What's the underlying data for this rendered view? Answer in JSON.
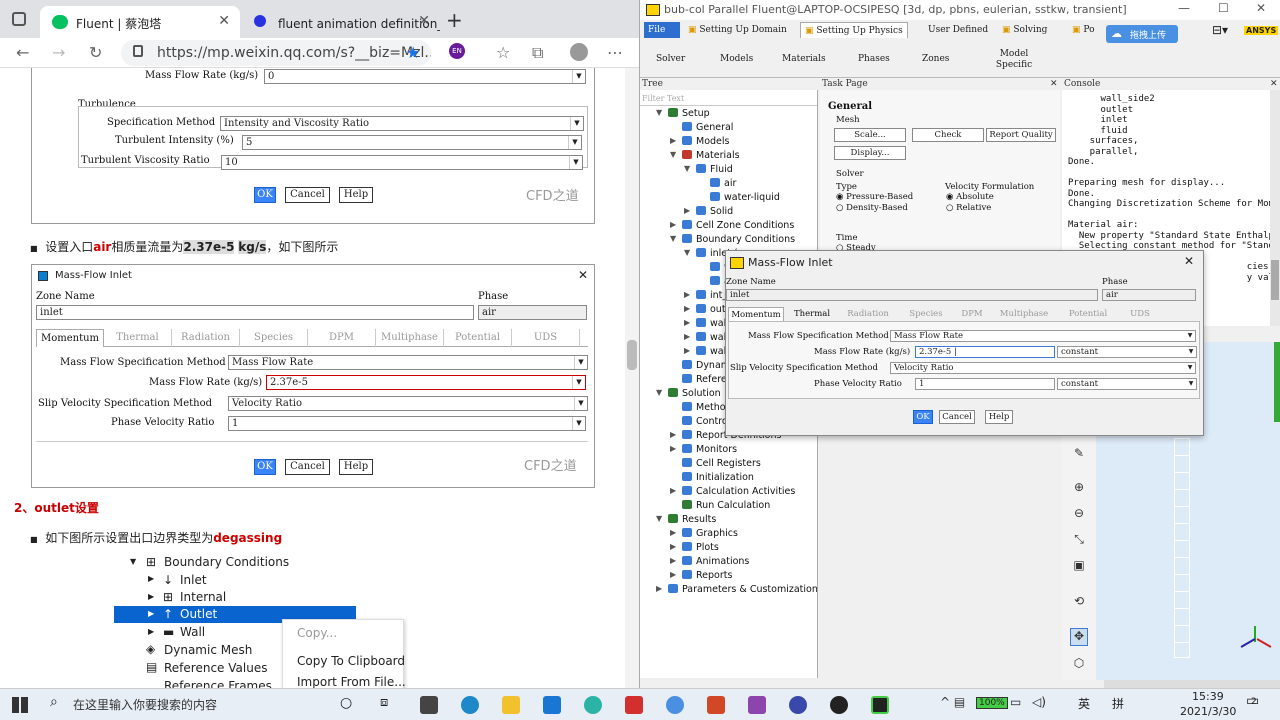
{
  "browser": {
    "tabs": [
      {
        "label": "Fluent | 蔡泡塔"
      },
      {
        "label": "fluent animation definition_百度"
      }
    ],
    "url": "https://mp.weixin.qq.com/s?__biz=Mzl...",
    "profile": "EN"
  },
  "article": {
    "fig1": {
      "mass_flow_label": "Mass Flow Rate (kg/s)",
      "mass_flow_value": "0",
      "turbulence": "Turbulence",
      "spec_label": "Specification Method",
      "spec_value": "Intensity and Viscosity Ratio",
      "ti_label": "Turbulent Intensity (%)",
      "ti_value": "5",
      "tvr_label": "Turbulent Viscosity Ratio",
      "tvr_value": "10",
      "ok": "OK",
      "cancel": "Cancel",
      "help": "Help",
      "watermark": "CFD之道"
    },
    "para1": {
      "pre": "设置入口",
      "air": "air",
      "mid": "相质量流量为",
      "val": "2.37e-5",
      "unit": "kg/s",
      "post": "，如下图所示"
    },
    "fig2": {
      "title": "Mass-Flow Inlet",
      "zone_label": "Zone Name",
      "zone_value": "inlet",
      "phase_label": "Phase",
      "phase_value": "air",
      "tabs": [
        "Momentum",
        "Thermal",
        "Radiation",
        "Species",
        "DPM",
        "Multiphase",
        "Potential",
        "UDS"
      ],
      "rows": [
        {
          "label": "Mass Flow Specification Method",
          "value": "Mass Flow Rate"
        },
        {
          "label": "Mass Flow Rate (kg/s)",
          "value": "2.37e-5"
        },
        {
          "label": "Slip Velocity Specification Method",
          "value": "Velocity Ratio"
        },
        {
          "label": "Phase Velocity Ratio",
          "value": "1"
        }
      ],
      "ok": "OK",
      "cancel": "Cancel",
      "help": "Help",
      "watermark": "CFD之道"
    },
    "heading2": "2、outlet设置",
    "para2": {
      "pre": "如下图所示设置出口边界类型为",
      "val": "degassing"
    },
    "tree": {
      "root": "Boundary Conditions",
      "items": [
        "Inlet",
        "Internal",
        "Outlet",
        "Wall",
        "Dynamic Mesh",
        "Reference Values",
        "Reference Frames"
      ]
    },
    "context_menu": [
      "Copy...",
      "Copy To Clipboard",
      "Import From File..."
    ]
  },
  "fluent": {
    "title": "bub-col Parallel Fluent@LAPTOP-OCSIPESQ  [3d, dp, pbns, eulerian, sstkw, transient]",
    "ribbon_tabs": [
      "File",
      "Setting Up Domain",
      "Setting Up Physics",
      "User Defined",
      "Solving",
      "Po"
    ],
    "ribbon_buttons": [
      "Solver",
      "Models",
      "Materials",
      "Phases",
      "Zones",
      "Model Specific"
    ],
    "cloud_label": "拖拽上传",
    "brand": "ANSYS",
    "panels": {
      "tree": "Tree",
      "task": "Task Page",
      "console": "Console"
    },
    "filter_placeholder": "Filter Text",
    "tree": [
      {
        "label": "Setup"
      },
      {
        "label": "General"
      },
      {
        "label": "Models"
      },
      {
        "label": "Materials"
      },
      {
        "label": "Fluid"
      },
      {
        "label": "air"
      },
      {
        "label": "water-liquid"
      },
      {
        "label": "Solid"
      },
      {
        "label": "Cell Zone Conditions"
      },
      {
        "label": "Boundary Conditions"
      },
      {
        "label": "inlet (n"
      },
      {
        "label": "wat"
      },
      {
        "label": "air"
      },
      {
        "label": "int_flu"
      },
      {
        "label": "outlet"
      },
      {
        "label": "wall_b"
      },
      {
        "label": "wall_s"
      },
      {
        "label": "wall_s"
      },
      {
        "label": "Dynamic"
      },
      {
        "label": "Reference"
      },
      {
        "label": "Solution"
      },
      {
        "label": "Methods"
      },
      {
        "label": "Controls"
      },
      {
        "label": "Report Definitions"
      },
      {
        "label": "Monitors"
      },
      {
        "label": "Cell Registers"
      },
      {
        "label": "Initialization"
      },
      {
        "label": "Calculation Activities"
      },
      {
        "label": "Run Calculation"
      },
      {
        "label": "Results"
      },
      {
        "label": "Graphics"
      },
      {
        "label": "Plots"
      },
      {
        "label": "Animations"
      },
      {
        "label": "Reports"
      },
      {
        "label": "Parameters & Customization"
      }
    ],
    "task": {
      "heading": "General",
      "mesh": "Mesh",
      "scale": "Scale...",
      "check": "Check",
      "report_quality": "Report Quality",
      "display": "Display...",
      "solver": "Solver",
      "type": "Type",
      "pressure_based": "Pressure-Based",
      "density_based": "Density-Based",
      "velocity_formulation": "Velocity Formulation",
      "absolute": "Absolute",
      "relative": "Relative",
      "time": "Time",
      "steady": "Steady"
    },
    "console": [
      "      wall_side2",
      "      outlet",
      "      inlet",
      "      fluid",
      "    surfaces,",
      "    parallel,",
      "Done.",
      "",
      "Preparing mesh for display...",
      "Done.",
      "Changing Discretization Scheme for Mom",
      "",
      "Material air:",
      "  New property \"Standard State Enthalp",
      "  Selecting constant method for \"Standa",
      "",
      "                                 cies or metho",
      "                                 y values bef"
    ],
    "dialog": {
      "title": "Mass-Flow Inlet",
      "zone_label": "Zone Name",
      "zone_value": "inlet",
      "phase_label": "Phase",
      "phase_value": "air",
      "tabs": [
        "Momentum",
        "Thermal",
        "Radiation",
        "Species",
        "DPM",
        "Multiphase",
        "Potential",
        "UDS"
      ],
      "rows": [
        {
          "label": "Mass Flow Specification Method",
          "value": "Mass Flow Rate"
        },
        {
          "label": "Mass Flow Rate (kg/s)",
          "value": "2.37e-5",
          "method": "constant"
        },
        {
          "label": "Slip Velocity Specification Method",
          "value": "Velocity Ratio"
        },
        {
          "label": "Phase Velocity Ratio",
          "value": "1",
          "method": "constant"
        }
      ],
      "ok": "OK",
      "cancel": "Cancel",
      "help": "Help"
    }
  },
  "taskbar": {
    "search_placeholder": "在这里输入你要搜索的内容",
    "battery": "100%",
    "time": "15:39",
    "date": "2021/3/30",
    "notifications": "2"
  }
}
